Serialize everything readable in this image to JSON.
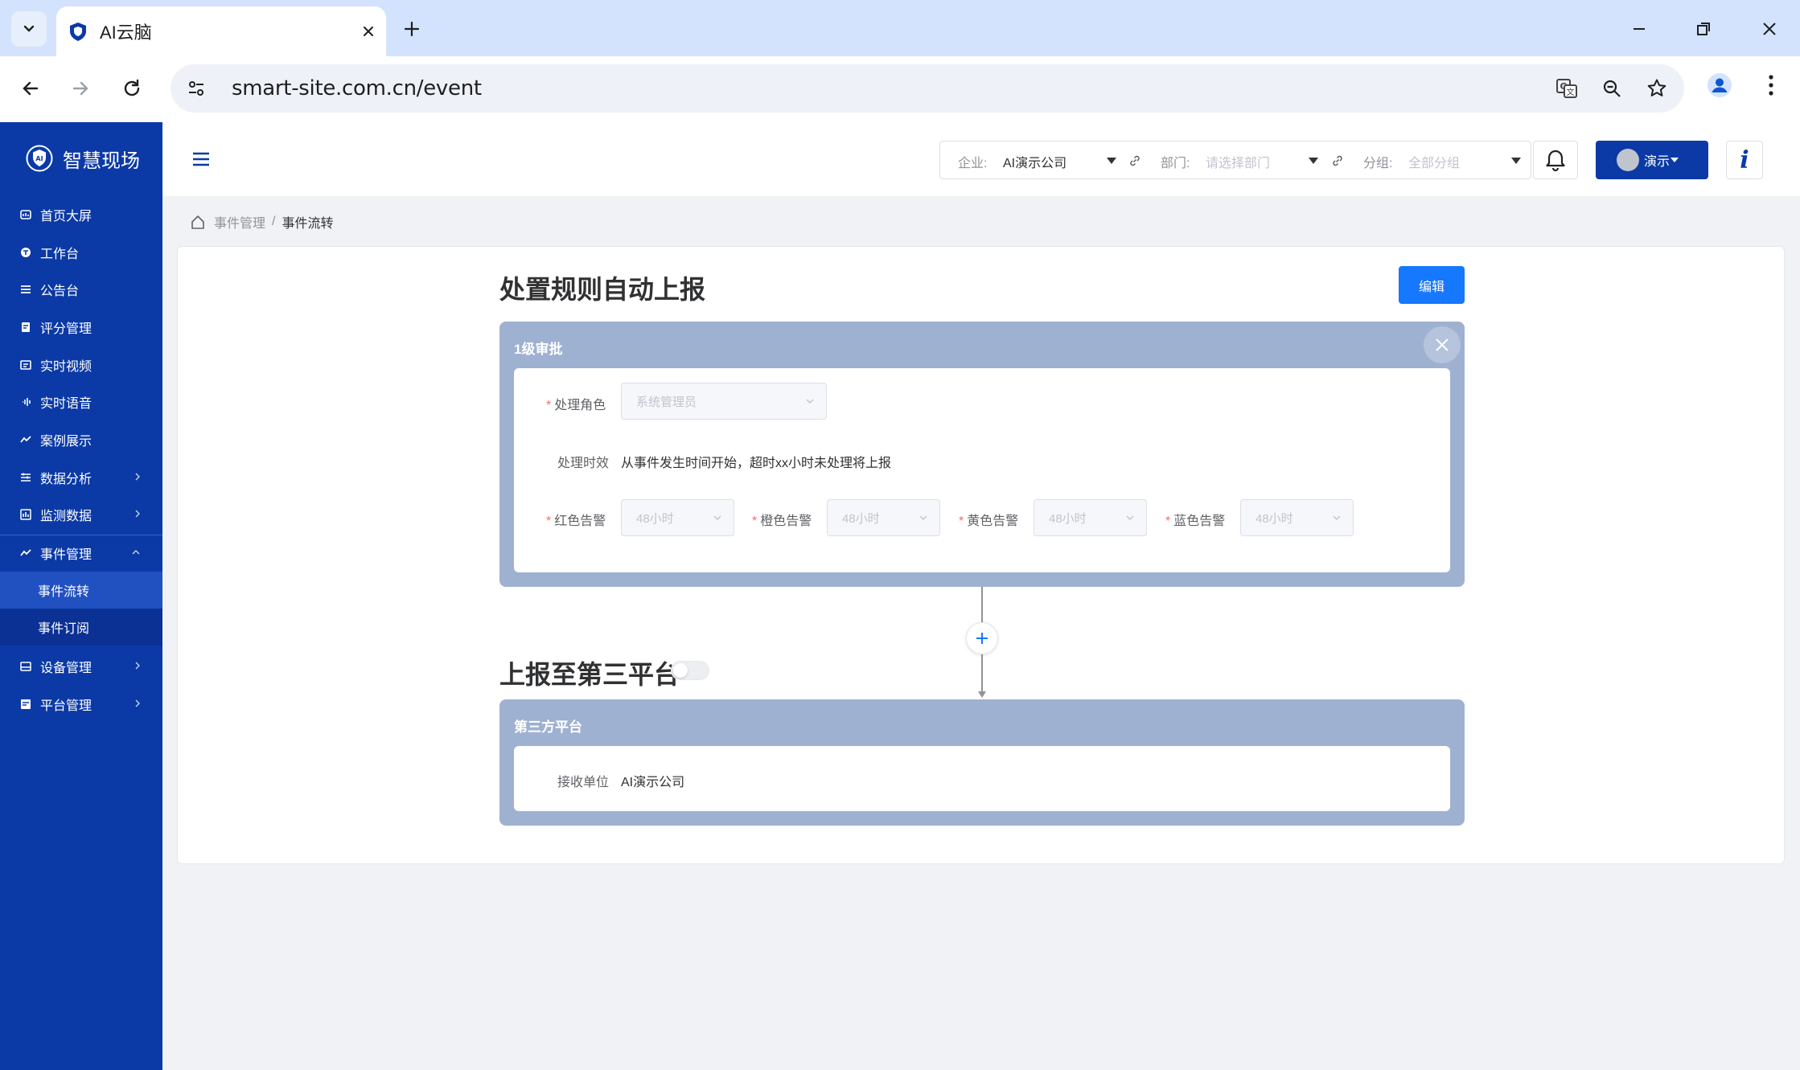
{
  "browser": {
    "tab_title": "AI云脑",
    "url": "smart-site.com.cn/event"
  },
  "sidebar": {
    "brand": "智慧现场",
    "items": [
      {
        "label": "首页大屏",
        "icon": "dashboard-icon"
      },
      {
        "label": "工作台",
        "icon": "workbench-icon"
      },
      {
        "label": "公告台",
        "icon": "notice-icon"
      },
      {
        "label": "评分管理",
        "icon": "score-icon"
      },
      {
        "label": "实时视频",
        "icon": "video-icon"
      },
      {
        "label": "实时语音",
        "icon": "voice-icon"
      },
      {
        "label": "案例展示",
        "icon": "case-icon"
      },
      {
        "label": "数据分析",
        "icon": "analysis-icon"
      },
      {
        "label": "监测数据",
        "icon": "monitor-icon"
      },
      {
        "label": "事件管理",
        "icon": "event-icon"
      },
      {
        "label": "设备管理",
        "icon": "device-icon"
      },
      {
        "label": "平台管理",
        "icon": "platform-icon"
      }
    ],
    "event_sub": [
      {
        "label": "事件流转",
        "active": true
      },
      {
        "label": "事件订阅",
        "active": false
      }
    ]
  },
  "header": {
    "company_label": "企业:",
    "company_value": "AI演示公司",
    "dept_label": "部门:",
    "dept_placeholder": "请选择部门",
    "group_label": "分组:",
    "group_value": "全部分组",
    "user_label": "演示",
    "info_label": "i"
  },
  "breadcrumb": {
    "parent": "事件管理",
    "separator": "/",
    "current": "事件流转"
  },
  "rules": {
    "title": "处置规则自动上报",
    "edit_label": "编辑",
    "level_title": "1级审批",
    "role_label": "处理角色",
    "role_value": "系统管理员",
    "timeliness_label": "处理时效",
    "timeliness_text": "从事件发生时间开始，超时xx小时未处理将上报",
    "alerts": [
      {
        "label": "红色告警",
        "value": "48小时"
      },
      {
        "label": "橙色告警",
        "value": "48小时"
      },
      {
        "label": "黄色告警",
        "value": "48小时"
      },
      {
        "label": "蓝色告警",
        "value": "48小时"
      }
    ]
  },
  "third": {
    "title": "上报至第三平台",
    "toggle_on": false,
    "panel_title": "第三方平台",
    "recv_label": "接收单位",
    "recv_value": "AI演示公司"
  },
  "colors": {
    "sidebar": "#0b3aa6",
    "primary": "#1677ff",
    "panel": "#9fb1d1",
    "required": "#f56c6c"
  }
}
